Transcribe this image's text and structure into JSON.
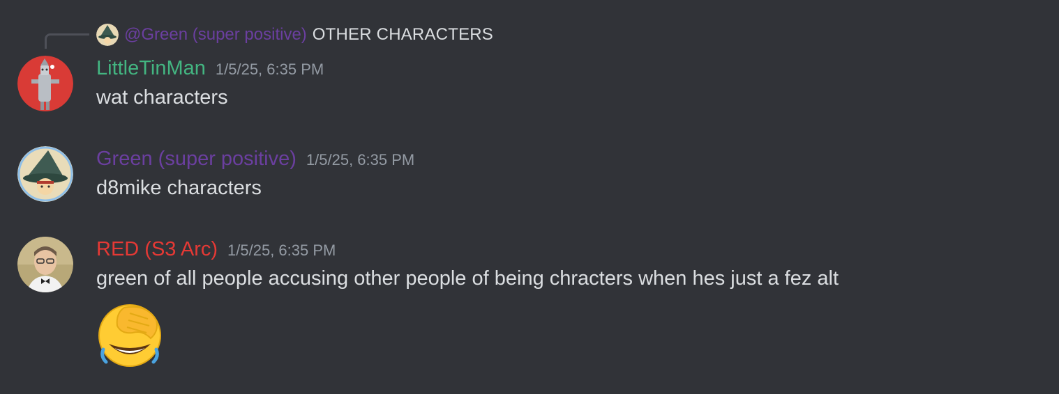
{
  "reply": {
    "author": "@Green (super positive)",
    "text": "OTHER CHARACTERS",
    "avatar_icon": "wizard-avatar-icon"
  },
  "messages": [
    {
      "username": "LittleTinMan",
      "username_color": "#43b581",
      "timestamp": "1/5/25, 6:35 PM",
      "content": "wat characters",
      "avatar_icon": "tin-man-avatar-icon"
    },
    {
      "username": "Green (super positive)",
      "username_color": "#6b3fa0",
      "timestamp": "1/5/25, 6:35 PM",
      "content": "d8mike characters",
      "avatar_icon": "wizard-avatar-icon"
    },
    {
      "username": "RED (S3 Arc)",
      "username_color": "#e53935",
      "timestamp": "1/5/25, 6:35 PM",
      "content": "green of all people accusing other people of being chracters when hes just a fez alt",
      "avatar_icon": "man-with-glasses-avatar-icon",
      "emoji": "face-palm-laughing-emoji"
    }
  ],
  "colors": {
    "background": "#313338",
    "timestamp": "#949ba4",
    "text": "#dbdee1"
  }
}
